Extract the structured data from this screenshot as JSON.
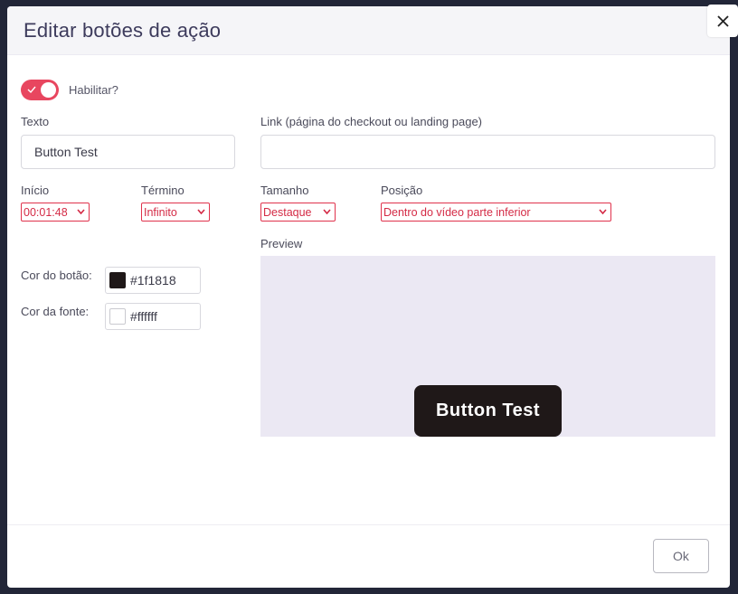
{
  "modal": {
    "title": "Editar botões de ação",
    "close_icon": "close-icon"
  },
  "enable": {
    "label": "Habilitar?",
    "checked": true,
    "color": "#e8465f"
  },
  "text_field": {
    "label": "Texto",
    "value": "Button Test"
  },
  "link_field": {
    "label": "Link (página do checkout ou landing page)",
    "value": ""
  },
  "start": {
    "label": "Início",
    "value": "00:01:48"
  },
  "end": {
    "label": "Término",
    "value": "Infinito"
  },
  "size": {
    "label": "Tamanho",
    "value": "Destaque"
  },
  "position": {
    "label": "Posição",
    "value": "Dentro do vídeo parte inferior"
  },
  "button_color": {
    "label": "Cor do botão:",
    "value": "#1f1818"
  },
  "font_color": {
    "label": "Cor da fonte:",
    "value": "#ffffff"
  },
  "preview": {
    "label": "Preview",
    "button_text": "Button Test",
    "background": "#ebe8f3"
  },
  "footer": {
    "ok_label": "Ok"
  }
}
